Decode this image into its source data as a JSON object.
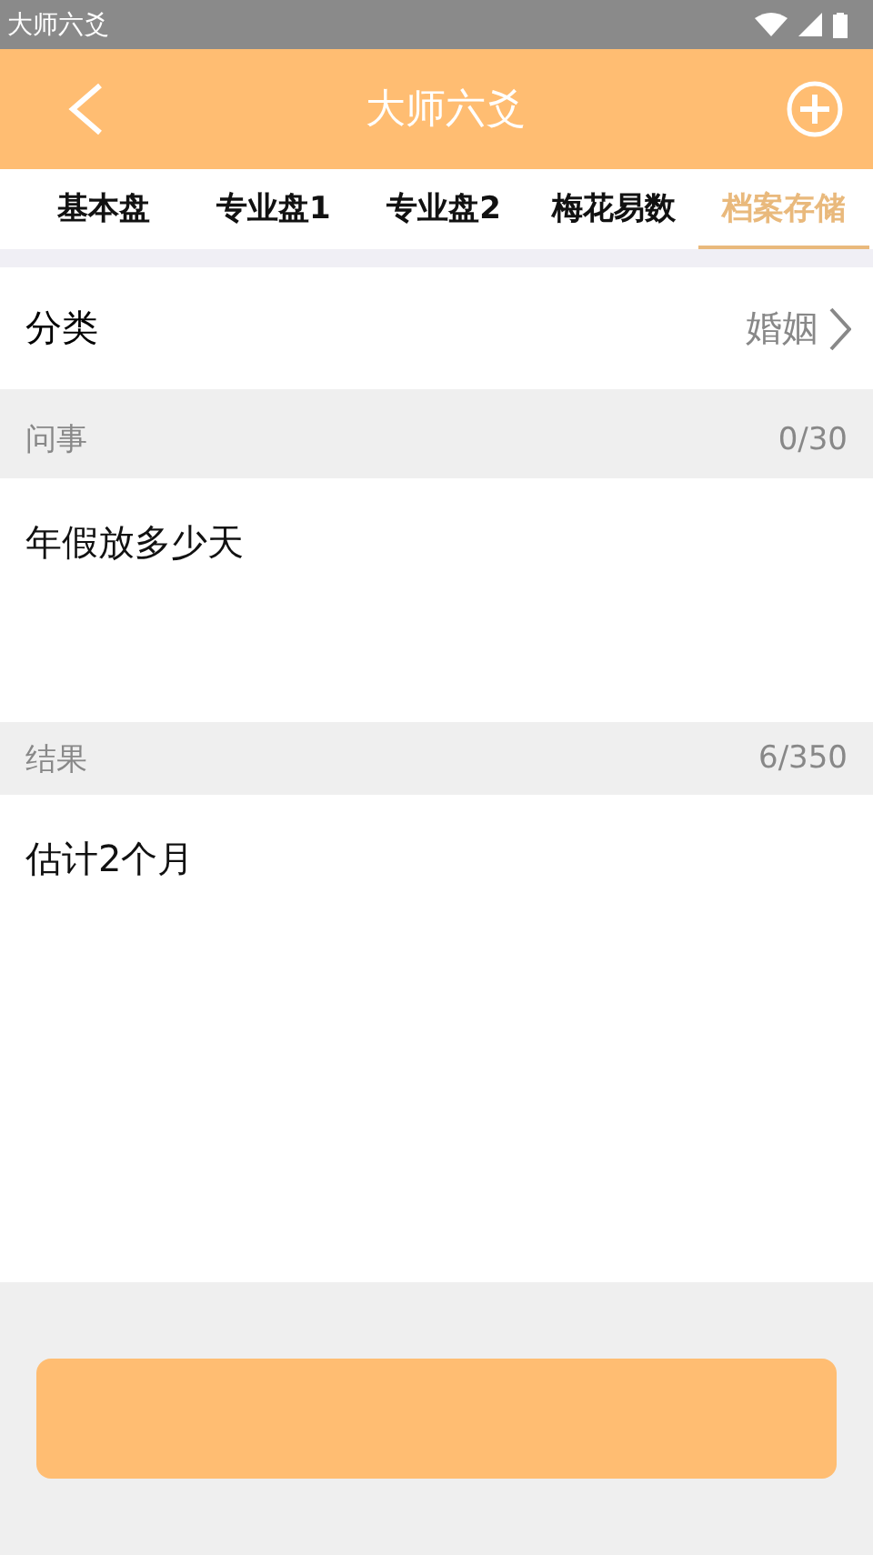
{
  "status_bar": {
    "app_name": "大师六爻"
  },
  "header": {
    "title": "大师六爻"
  },
  "tabs": [
    {
      "label": "基本盘",
      "selected": false
    },
    {
      "label": "专业盘1",
      "selected": false
    },
    {
      "label": "专业盘2",
      "selected": false
    },
    {
      "label": "梅花易数",
      "selected": false
    },
    {
      "label": "档案存储",
      "selected": true
    }
  ],
  "category": {
    "label": "分类",
    "value": "婚姻"
  },
  "sections": [
    {
      "label": "问事",
      "count": "0/30",
      "value": "年假放多少天"
    },
    {
      "label": "结果",
      "count": "6/350",
      "value": "估计2个月"
    }
  ],
  "save_button": {
    "kind": "button"
  }
}
